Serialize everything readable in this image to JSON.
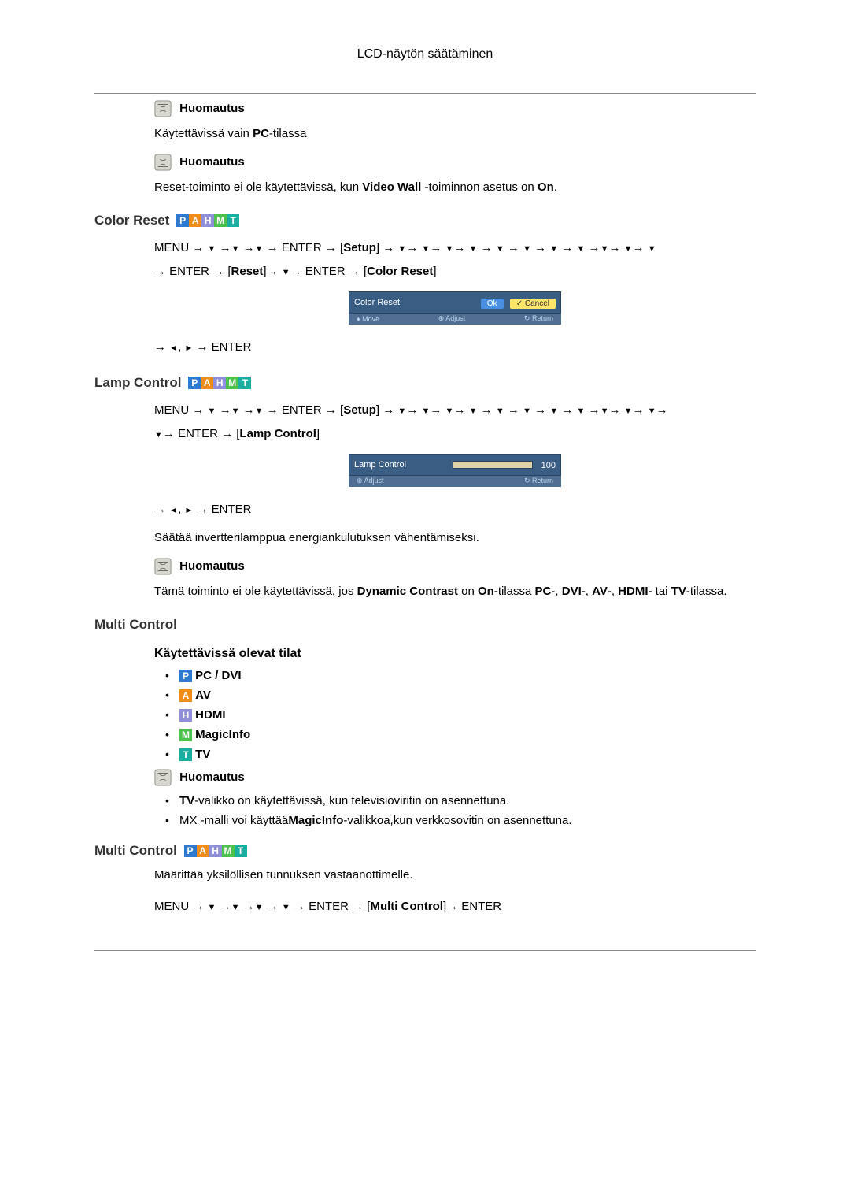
{
  "header": {
    "title": "LCD-näytön säätäminen"
  },
  "note1": {
    "label": "Huomautus",
    "text_prefix": "Käytettävissä vain ",
    "text_bold": "PC",
    "text_suffix": "-tilassa"
  },
  "note2": {
    "label": "Huomautus",
    "text_pre": "Reset-toiminto ei ole käytettävissä, kun ",
    "text_b": "Video Wall",
    "text_mid": " -toiminnon asetus on ",
    "text_b2": "On",
    "text_end": "."
  },
  "color_reset": {
    "title": "Color Reset",
    "nav_line1_menu": "MENU",
    "nav_enter": "ENTER",
    "nav_setup": "Setup",
    "nav_reset": "Reset",
    "nav_color_reset": "Color Reset",
    "osd_label": "Color Reset",
    "osd_ok": "Ok",
    "osd_cancel": "Cancel",
    "osd_move": "Move",
    "osd_adjust": "Adjust",
    "osd_return": "Return",
    "nav_tail": "ENTER"
  },
  "lamp_control": {
    "title": "Lamp Control",
    "nav_menu": "MENU",
    "nav_enter": "ENTER",
    "nav_setup": "Setup",
    "nav_lamp": "Lamp Control",
    "osd_label": "Lamp Control",
    "osd_value": "100",
    "osd_adjust": "Adjust",
    "osd_return": "Return",
    "nav_tail": "ENTER",
    "desc": "Säätää invertterilamppua energiankulutuksen vähentämiseksi.",
    "note_label": "Huomautus",
    "note_pre": "Tämä toiminto ei ole käytettävissä, jos ",
    "note_b1": "Dynamic Contrast",
    "note_mid1": " on ",
    "note_b2": "On",
    "note_mid2": "-tilassa ",
    "note_b3": "PC",
    "note_mid3": "-, ",
    "note_b4": "DVI",
    "note_mid4": "-, ",
    "note_b5": "AV",
    "note_mid5": "-, ",
    "note_b6": "HDMI",
    "note_mid6": "- tai ",
    "note_b7": "TV",
    "note_end": "-tilassa."
  },
  "multi_control": {
    "title": "Multi Control",
    "subtitle": "Käytettävissä olevat tilat",
    "modes": [
      {
        "letter": "P",
        "label": "PC / DVI"
      },
      {
        "letter": "A",
        "label": "AV"
      },
      {
        "letter": "H",
        "label": "HDMI"
      },
      {
        "letter": "M",
        "label": "MagicInfo"
      },
      {
        "letter": "T",
        "label": "TV"
      }
    ],
    "note_label": "Huomautus",
    "note_items": [
      {
        "b": "TV",
        "text": "-valikko on käytettävissä, kun televisioviritin on asennettuna."
      },
      {
        "pre": "MX -malli voi käyttää",
        "b": "MagicInfo",
        "text": "-valikkoa,kun verkkosovitin on asennettuna."
      }
    ],
    "title2": "Multi Control",
    "desc2": "Määrittää yksilöllisen tunnuksen vastaanottimelle.",
    "nav_menu": "MENU",
    "nav_enter": "ENTER",
    "nav_mc": "Multi Control"
  }
}
